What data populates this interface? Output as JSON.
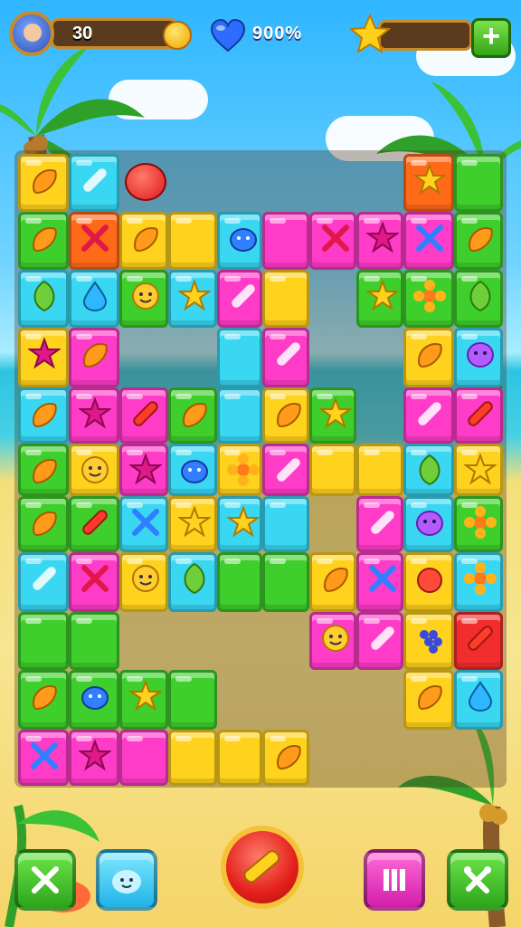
{
  "hud": {
    "coins": "30",
    "lives_text": "900%",
    "icons": [
      "player-avatar",
      "coin-icon",
      "heart-icon",
      "star-icon",
      "plus-icon"
    ]
  },
  "board": {
    "tile_colors": {
      "yellow": "#ffd21e",
      "green": "#3fcf2c",
      "blue": "#3ad7f2",
      "pink": "#ff3cc8",
      "orange": "#ff6a18",
      "red": "#f22d2d"
    }
  },
  "bottom_bar": {
    "buttons": [
      "hammer-booster",
      "smiley-booster",
      "color-bomb-booster",
      "shuffle-booster",
      "swap-booster"
    ]
  }
}
